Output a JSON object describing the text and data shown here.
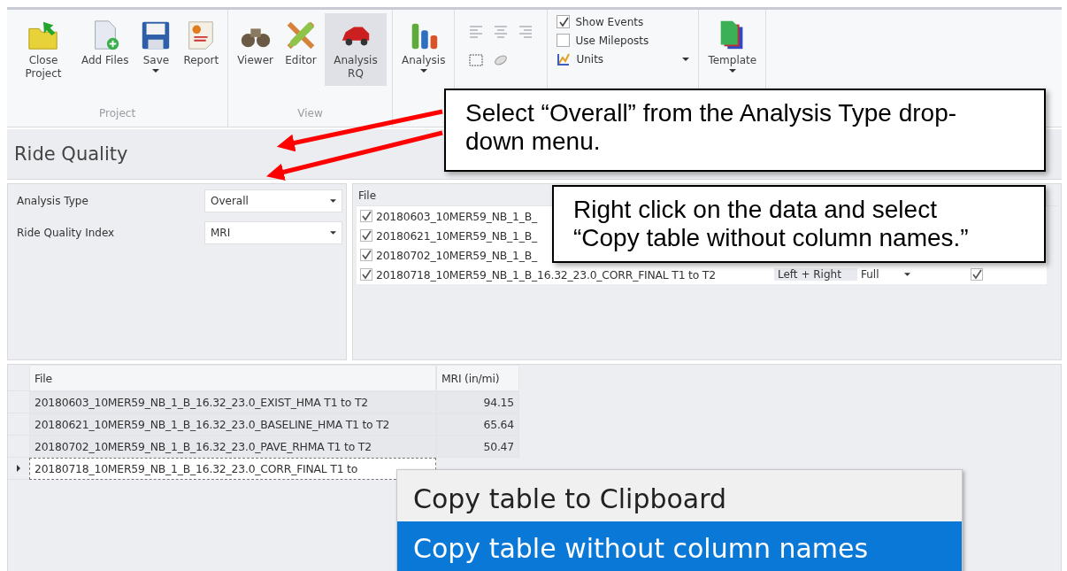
{
  "ribbon": {
    "groups": [
      {
        "label": "Project",
        "buttons": [
          {
            "label": "Close Project",
            "dropdown": false
          },
          {
            "label": "Add Files",
            "dropdown": false
          },
          {
            "label": "Save",
            "dropdown": true
          },
          {
            "label": "Report",
            "dropdown": false
          }
        ]
      },
      {
        "label": "View",
        "buttons": [
          {
            "label": "Viewer",
            "dropdown": false,
            "selected": false
          },
          {
            "label": "Editor",
            "dropdown": false,
            "selected": false
          },
          {
            "label": "Analysis RQ",
            "dropdown": false,
            "selected": true
          }
        ]
      },
      {
        "buttons": [
          {
            "label": "Analysis",
            "dropdown": true
          }
        ]
      }
    ],
    "options": [
      {
        "kind": "checkbox",
        "label": "Show Events",
        "checked": true
      },
      {
        "kind": "checkbox",
        "label": "Use Mileposts",
        "checked": false
      },
      {
        "kind": "dropdown",
        "label": "Units"
      }
    ],
    "template": {
      "label": "Template",
      "dropdown": true
    }
  },
  "panel": {
    "title": "Ride Quality"
  },
  "settings": [
    {
      "label": "Analysis Type",
      "value": "Overall"
    },
    {
      "label": "Ride Quality Index",
      "value": "MRI"
    }
  ],
  "file_list": {
    "columns": [
      "File"
    ],
    "rows": [
      {
        "name": "20180603_10MER59_NB_1_B_",
        "checked": true
      },
      {
        "name": "20180621_10MER59_NB_1_B_",
        "checked": true
      },
      {
        "name": "20180702_10MER59_NB_1_B_",
        "checked": true
      },
      {
        "name": "20180718_10MER59_NB_1_B_16.32_23.0_CORR_FINAL T1 to T2",
        "checked": true,
        "column_2": "Left + Right",
        "column_3": "Full",
        "column_4": true
      }
    ]
  },
  "results": {
    "columns": [
      "File",
      "MRI (in/mi)"
    ],
    "rows": [
      {
        "file": "20180603_10MER59_NB_1_B_16.32_23.0_EXIST_HMA T1 to T2",
        "value": "94.15",
        "selected": false
      },
      {
        "file": "20180621_10MER59_NB_1_B_16.32_23.0_BASELINE_HMA T1 to T2",
        "value": "65.64",
        "selected": false
      },
      {
        "file": "20180702_10MER59_NB_1_B_16.32_23.0_PAVE_RHMA T1 to T2",
        "value": "50.47",
        "selected": false
      },
      {
        "file": "20180718_10MER59_NB_1_B_16.32_23.0_CORR_FINAL T1 to",
        "selected": true
      }
    ]
  },
  "context_menu": {
    "items": [
      {
        "label": "Copy table to Clipboard",
        "selected": false
      },
      {
        "label": "Copy table without column names",
        "selected": true
      }
    ]
  },
  "callouts": [
    {
      "text": "Select “Overall” from the Analysis Type drop-down menu."
    },
    {
      "text": "Right click on the data and select “Copy table without column names.”"
    }
  ]
}
